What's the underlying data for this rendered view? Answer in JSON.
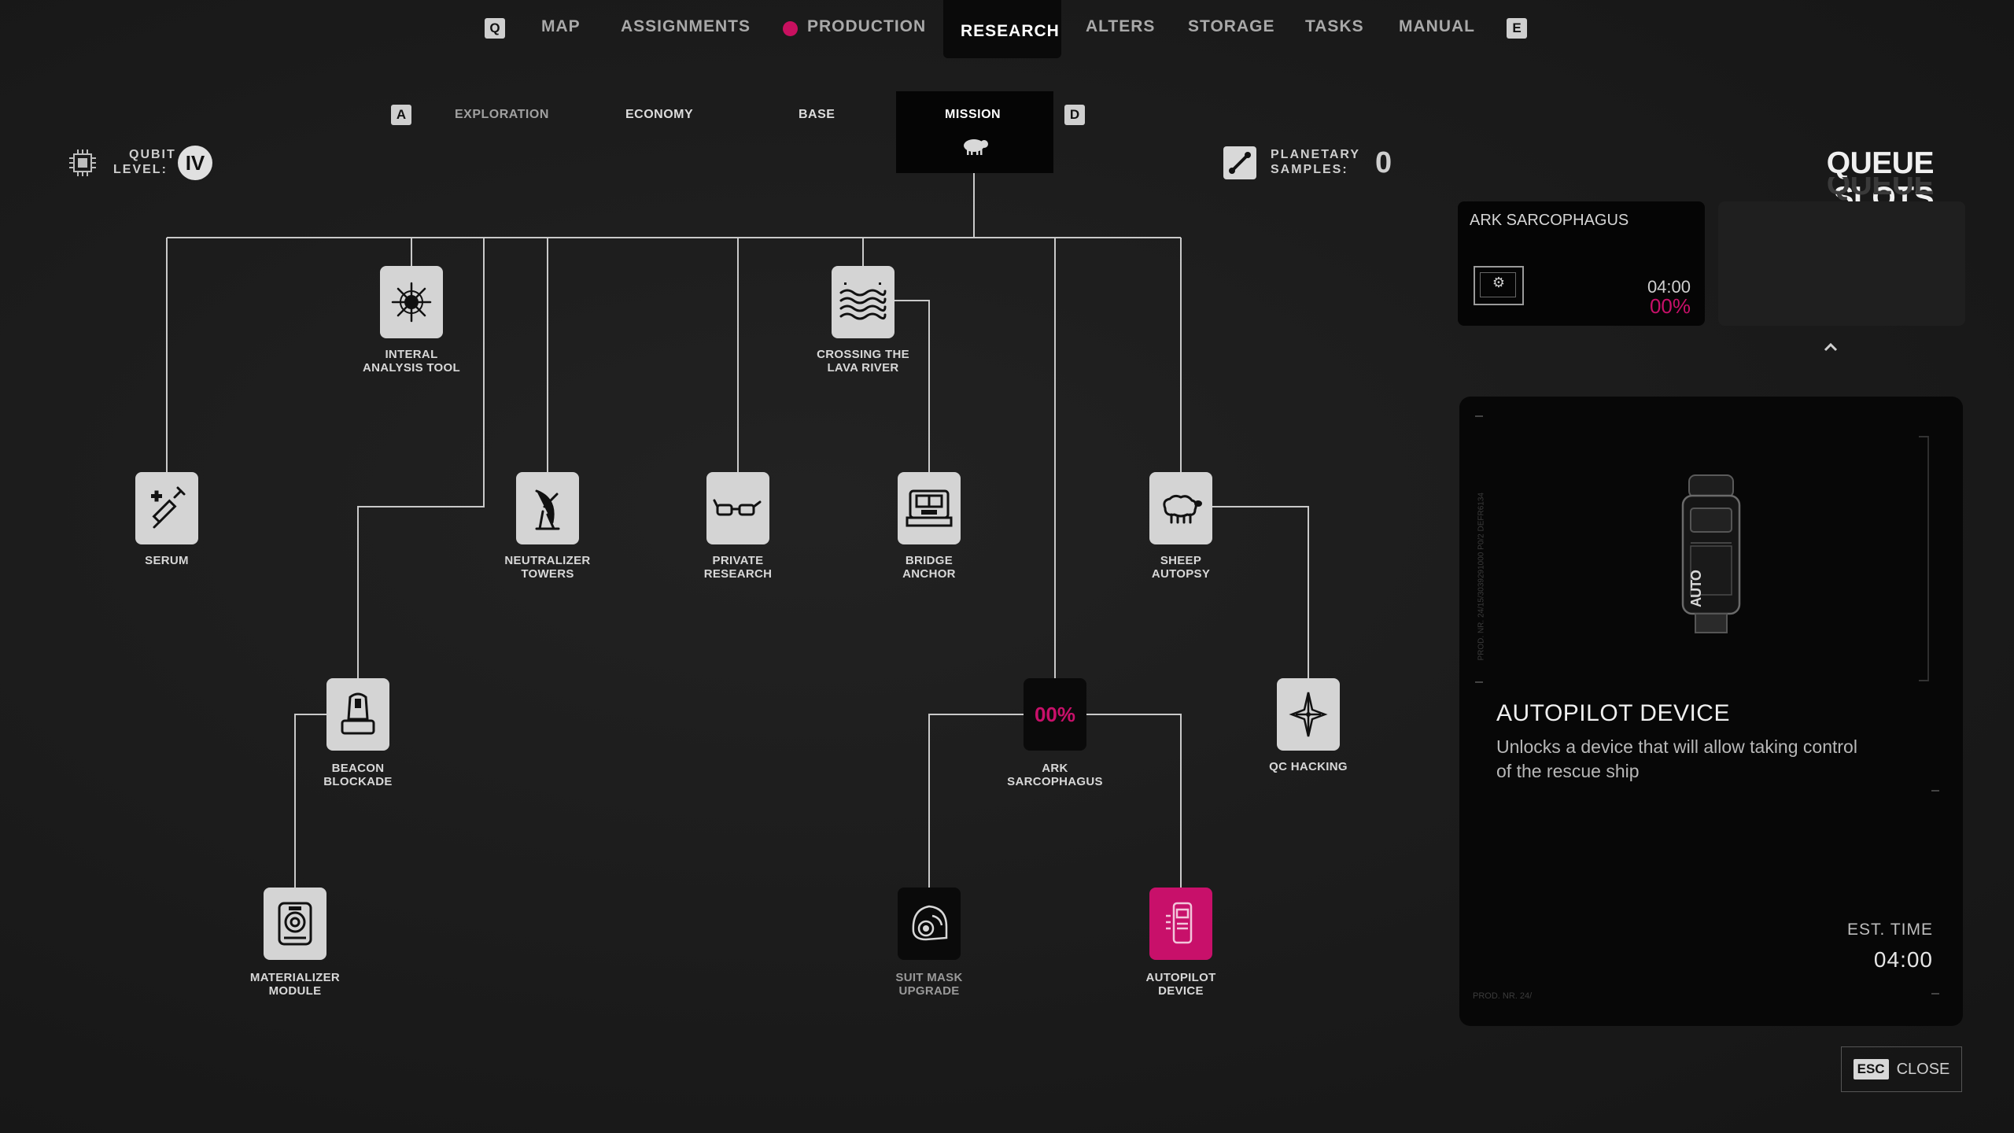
{
  "top_nav": {
    "prev_key": "Q",
    "next_key": "E",
    "items": [
      {
        "label": "MAP"
      },
      {
        "label": "ASSIGNMENTS"
      },
      {
        "label": "PRODUCTION"
      },
      {
        "label": "RESEARCH"
      },
      {
        "label": "ALTERS"
      },
      {
        "label": "STORAGE"
      },
      {
        "label": "TASKS"
      },
      {
        "label": "MANUAL"
      }
    ],
    "active": "RESEARCH",
    "alert_color": "#c8105f"
  },
  "sub_nav": {
    "prev_key": "A",
    "next_key": "D",
    "items": [
      {
        "label": "EXPLORATION"
      },
      {
        "label": "ECONOMY"
      },
      {
        "label": "BASE"
      },
      {
        "label": "MISSION"
      }
    ],
    "active": "MISSION",
    "active_icon": "sheep-icon"
  },
  "qubit": {
    "label_line1": "QUBIT",
    "label_line2": "LEVEL:",
    "level": "IV",
    "icon": "chip-icon"
  },
  "samples": {
    "label_line1": "PLANETARY",
    "label_line2": "SAMPLES:",
    "value": "0",
    "icon": "syringe-sample-icon"
  },
  "tree": {
    "nodes": [
      {
        "id": "serum",
        "line1": "SERUM",
        "line2": "",
        "icon": "syringe-icon"
      },
      {
        "id": "interal",
        "line1": "INTERAL",
        "line2": "ANALYSIS TOOL",
        "icon": "starburst-icon"
      },
      {
        "id": "neutralizer",
        "line1": "NEUTRALIZER",
        "line2": "TOWERS",
        "icon": "satellite-dish-icon"
      },
      {
        "id": "private",
        "line1": "PRIVATE",
        "line2": "RESEARCH",
        "icon": "glasses-icon"
      },
      {
        "id": "lava",
        "line1": "CROSSING THE",
        "line2": "LAVA RIVER",
        "icon": "waves-icon"
      },
      {
        "id": "bridge",
        "line1": "BRIDGE",
        "line2": "ANCHOR",
        "icon": "anchor-machine-icon"
      },
      {
        "id": "sheep",
        "line1": "SHEEP",
        "line2": "AUTOPSY",
        "icon": "sheep-icon"
      },
      {
        "id": "beacon",
        "line1": "BEACON",
        "line2": "BLOCKADE",
        "icon": "beacon-icon"
      },
      {
        "id": "ark",
        "line1": "ARK",
        "line2": "SARCOPHAGUS",
        "icon": "progress",
        "progress": "00%"
      },
      {
        "id": "qc",
        "line1": "QC HACKING",
        "line2": "",
        "icon": "compass-star-icon"
      },
      {
        "id": "materializer",
        "line1": "MATERIALIZER",
        "line2": "MODULE",
        "icon": "speaker-module-icon"
      },
      {
        "id": "suitmask",
        "line1": "SUIT MASK",
        "line2": "UPGRADE",
        "icon": "helmet-icon"
      },
      {
        "id": "autopilot",
        "line1": "AUTOPILOT",
        "line2": "DEVICE",
        "icon": "autopilot-icon"
      }
    ]
  },
  "queue": {
    "title": "QUEUE SLOTS",
    "slot1": {
      "name": "ARK SARCOPHAGUS",
      "time": "04:00",
      "progress": "00%",
      "icon": "gear-screen-icon"
    },
    "expand_icon": "chevron-up-icon"
  },
  "detail": {
    "title": "AUTOPILOT DEVICE",
    "desc_line1": "Unlocks a device that will allow taking control",
    "desc_line2": "of the rescue ship",
    "est_label": "EST. TIME",
    "est_value": "04:00",
    "side_text": "PROD. NR. 24/15/3039291000 P0/2  DEFR6134",
    "bottom_text": "PROD. NR. 24/",
    "device_label": "AUTO"
  },
  "close": {
    "key": "ESC",
    "label": "CLOSE"
  },
  "colors": {
    "accent": "#c8106a",
    "node": "#d4d4d4",
    "line": "#c9c9c9"
  }
}
